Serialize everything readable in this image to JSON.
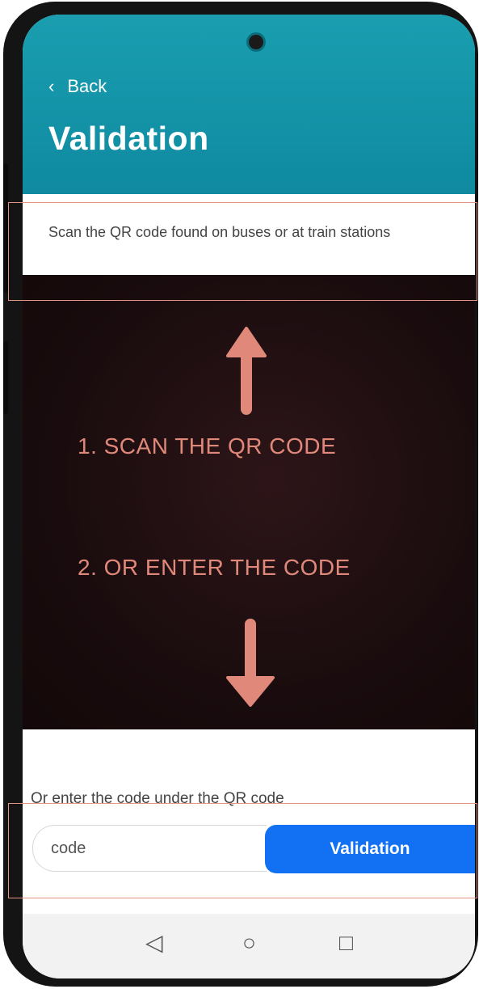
{
  "header": {
    "back_label": "Back",
    "title": "Validation",
    "color": "#1596aa"
  },
  "instruction": {
    "text": "Scan the QR code found on buses or at train stations"
  },
  "camera_overlay": {
    "step1": "1. SCAN THE QR CODE",
    "step2": "2. OR ENTER THE CODE",
    "accent_color": "#e0897a"
  },
  "code_entry": {
    "hint": "Or enter the code under the QR code",
    "input_placeholder": "code",
    "button_label": "Validation",
    "button_color": "#1271f3"
  },
  "navbar": {
    "back_icon": "◁",
    "home_icon": "○",
    "recents_icon": "□"
  }
}
